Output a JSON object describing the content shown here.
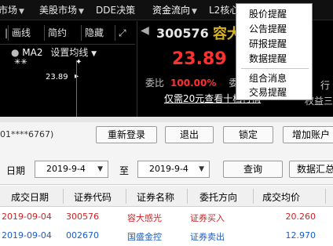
{
  "menu": {
    "items": [
      {
        "label": "市场"
      },
      {
        "label": "美股市场"
      },
      {
        "label": "DDE决策"
      },
      {
        "label": "资金流向"
      },
      {
        "label": "L2核心"
      }
    ]
  },
  "toolbar": {
    "items": [
      "画线",
      "简约",
      "隐藏"
    ],
    "prefix": "|"
  },
  "chart": {
    "indicator": "MA2",
    "settings_label": "设置均线",
    "price_marker": "23.89",
    "top_markers": "✳✳"
  },
  "quote": {
    "code": "300576",
    "name": "容大",
    "last_price": "23.89",
    "ratio_label": "委比",
    "ratio_value": "100.00%",
    "vol_label": "委量",
    "ad_text": "仅需20元查看十档行情",
    "side_labels": [
      "行",
      "权益三"
    ]
  },
  "dropdown": {
    "items": [
      "股价提醒",
      "公告提醒",
      "研报提醒",
      "数据提醒",
      "组合消息",
      "交易提醒"
    ]
  },
  "account": {
    "masked_id": "01****6767)",
    "buttons": [
      "重新登录",
      "退出",
      "锁定",
      "增加账户"
    ]
  },
  "filter": {
    "date_label": "日期",
    "from_date": "2019-9-4",
    "to_label": "至",
    "to_date": "2019-9-4",
    "query_button": "查询",
    "summary_button": "数据汇总"
  },
  "table": {
    "headers": [
      "成交日期",
      "证券代码",
      "证券名称",
      "委托方向",
      "成交均价"
    ],
    "rows": [
      {
        "date": "2019-09-04",
        "code": "300576",
        "name": "容大感光",
        "direction": "证券买入",
        "avg_price": "20.260",
        "color": "#d42020"
      },
      {
        "date": "2019-09-04",
        "code": "002670",
        "name": "国盛金控",
        "direction": "证券卖出",
        "avg_price": "12.970",
        "color": "#1a5ec8"
      }
    ]
  },
  "colors": {
    "up": "#ff3030",
    "buy_text": "#d42020",
    "sell_text": "#1a5ec8",
    "stock_name": "#d8b420"
  }
}
